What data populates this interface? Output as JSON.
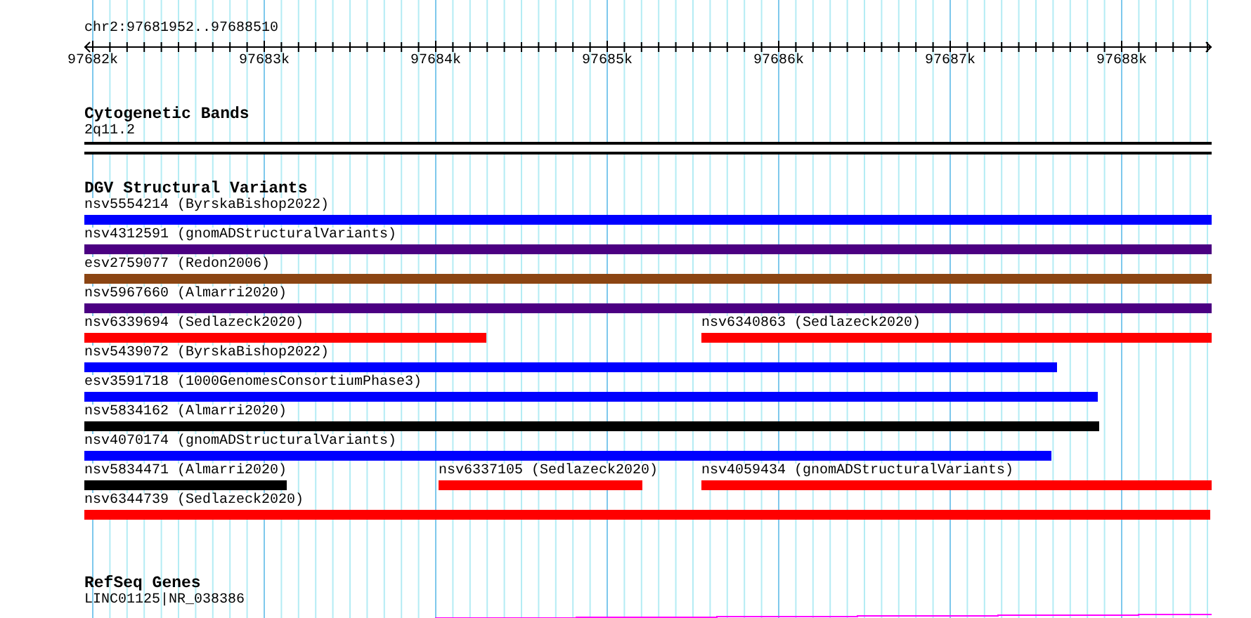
{
  "ruler": {
    "location": "chr2:97681952..97688510",
    "ticks": [
      "97682k",
      "97683k",
      "97684k",
      "97685k",
      "97686k",
      "97687k",
      "97688k"
    ]
  },
  "tracks": [
    {
      "kind": "bands",
      "title": "Cytogenetic Bands",
      "features": [
        {
          "label": "2q11.2"
        }
      ]
    },
    {
      "kind": "variants",
      "title": "DGV Structural Variants",
      "rows": [
        {
          "features": [
            {
              "label": "nsv5554214 (ByrskaBishop2022)",
              "color": "#0000ff"
            }
          ]
        },
        {
          "features": [
            {
              "label": "nsv4312591 (gnomADStructuralVariants)",
              "color": "#4b0082"
            }
          ]
        },
        {
          "features": [
            {
              "label": "esv2759077 (Redon2006)",
              "color": "#8b4513"
            }
          ]
        },
        {
          "features": [
            {
              "label": "nsv5967660 (Almarri2020)",
              "color": "#4b0082"
            }
          ]
        },
        {
          "features": [
            {
              "label": "nsv6339694 (Sedlazeck2020)",
              "color": "#ff0000"
            },
            {
              "label": "nsv6340863 (Sedlazeck2020)",
              "color": "#ff0000"
            }
          ]
        },
        {
          "features": [
            {
              "label": "nsv5439072 (ByrskaBishop2022)",
              "color": "#0000ff"
            }
          ]
        },
        {
          "features": [
            {
              "label": "esv3591718 (1000GenomesConsortiumPhase3)",
              "color": "#0000ff"
            }
          ]
        },
        {
          "features": [
            {
              "label": "nsv5834162 (Almarri2020)",
              "color": "#000000"
            }
          ]
        },
        {
          "features": [
            {
              "label": "nsv4070174 (gnomADStructuralVariants)",
              "color": "#0000ff"
            }
          ]
        },
        {
          "features": [
            {
              "label": "nsv5834471 (Almarri2020)",
              "color": "#000000"
            },
            {
              "label": "nsv6337105 (Sedlazeck2020)",
              "color": "#ff0000"
            },
            {
              "label": "nsv4059434 (gnomADStructuralVariants)",
              "color": "#ff0000"
            }
          ]
        },
        {
          "features": [
            {
              "label": "nsv6344739 (Sedlazeck2020)",
              "color": "#ff0000"
            }
          ]
        }
      ]
    },
    {
      "kind": "genes",
      "title": "RefSeq Genes",
      "features": [
        {
          "label": "LINC01125|NR_038386"
        }
      ]
    }
  ]
}
